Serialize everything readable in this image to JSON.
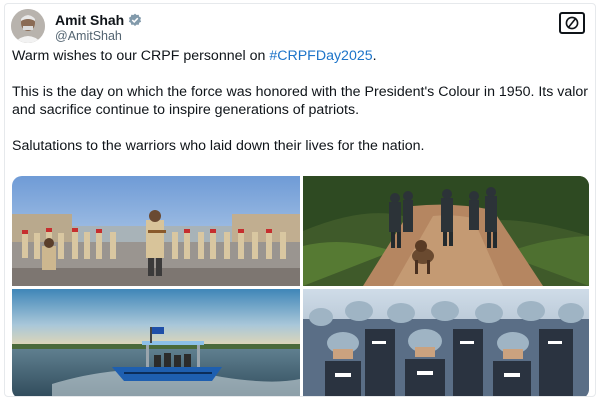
{
  "user": {
    "name": "Amit Shah",
    "handle": "@AmitShah"
  },
  "tweet": {
    "line1_prefix": "Warm wishes to our CRPF personnel on ",
    "hashtag": "#CRPFDay2025",
    "line1_suffix": ".",
    "paragraph2": "This is the day on which the force was honored with the President's Colour in 1950. Its valor and sacrifice continue to inspire generations of patriots.",
    "paragraph3": "Salutations to the warriors who laid down their lives for the nation."
  },
  "icons": {
    "verified": "verified-badge-icon",
    "x_logo": "x-logo-icon"
  },
  "colors": {
    "hashtag": "#1d74c9",
    "text": "#0f1419",
    "secondary": "#536471",
    "verified": "#829aab"
  }
}
